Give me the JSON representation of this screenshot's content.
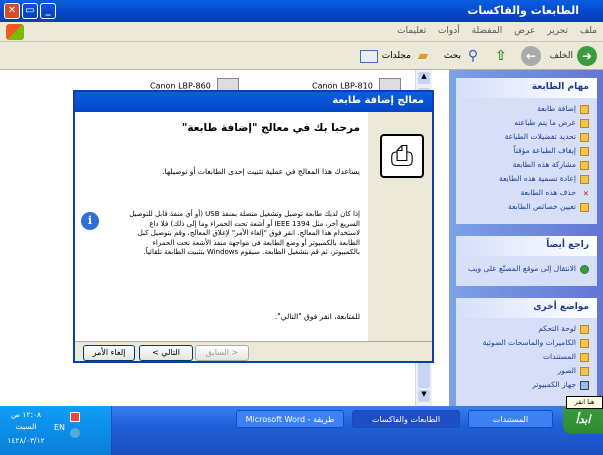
{
  "window": {
    "title": "الطابعات والفاكسات"
  },
  "menu": [
    "ملف",
    "تحرير",
    "عرض",
    "المفضلة",
    "أدوات",
    "تعليمات"
  ],
  "toolbar": {
    "back": "الخلف",
    "search": "بحث",
    "folders": "مجلدات"
  },
  "printers": [
    "Canon LBP-810",
    "Canon LBP-860"
  ],
  "printer_tasks": {
    "title": "مهام الطابعة",
    "items": [
      "إضافة طابعة",
      "عرض ما يتم طباعته",
      "تحديد تفضيلات الطباعة",
      "إيقاف الطباعة مؤقتاً",
      "مشاركة هذه الطابعة",
      "إعادة تسمية هذه الطابعة",
      "حذف هذه الطابعة",
      "تعيين خصائص الطابعة"
    ]
  },
  "see_also": {
    "title": "راجع أيضاً",
    "items": [
      "الانتقال إلى موقع المصنّع على ويب"
    ]
  },
  "other_places": {
    "title": "مواضع أخرى",
    "items": [
      "لوحة التحكم",
      "الكاميرات والماسحات الضوئية",
      "المستندات",
      "الصور",
      "جهاز الكمبيوتر"
    ]
  },
  "dialog": {
    "title": "معالج إضافة طابعة",
    "heading": "مرحبا بك في معالج \"إضافة طابعة\"",
    "intro": "يساعدك هذا المعالج في عملية تثبيت إحدى الطابعات أو توصيلها.",
    "info": "إذا كان لديك طابعة توصيل وتشغيل متصلة بمنفذ USB (أو أي منفذ قابل للتوصيل السريع آخر، مثل IEEE 1394 أو أشعة تحت الحمراء وما إلى ذلك) فلا داع لاستخدام هذا المعالج. انقر فوق \"إلغاء الأمر\" لإغلاق المعالج، وقم بتوصيل كبل الطابعة بالكمبيوتر أو وضع الطابعة في مواجهة منفذ الأشعة تحت الحمراء بالكمبيوتر، ثم قم بتشغيل الطابعة. سيقوم Windows بتثبيت الطابعة تلقائياً.",
    "continue": "للمتابعة، انقر فوق \"التالي\".",
    "back_button": "< السابق",
    "next_button": "التالي >",
    "cancel_button": "إلغاء الأمر"
  },
  "taskbar": {
    "start": "ابدأ",
    "tasks": [
      "المستندات",
      "الطابعات والفاكسات",
      "طريقة - Microsoft Word"
    ],
    "tooltip": "هنا انقر",
    "lang": "EN",
    "time": "١٢:٠٨ ص",
    "day": "السبت",
    "date": "١٤٢٨/٠٣/١٢"
  },
  "colors": {
    "titlebar": "#0646c8",
    "taskpane": "#7ba2e7",
    "start": "#2e8a2e"
  }
}
